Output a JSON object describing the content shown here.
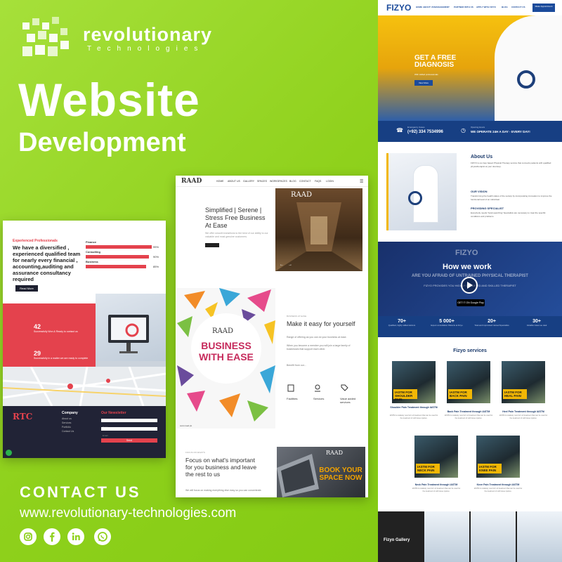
{
  "brand": {
    "name": "revolutionary",
    "sub": "Technologies"
  },
  "headline": "Website",
  "subheadline": "Development",
  "contact": {
    "title": "CONTACT US",
    "url": "www.revolutionary-technologies.com"
  },
  "social_icons": [
    "instagram-icon",
    "facebook-icon",
    "linkedin-icon",
    "whatsapp-icon"
  ],
  "colors": {
    "background": "#8fd11c",
    "accent_red": "#e4424d",
    "fizyo_blue": "#173f83",
    "fizyo_yellow": "#f2b705",
    "raad_magenta": "#c62a5b"
  },
  "left_mock": {
    "kicker": "Experienced Professionals",
    "heading": "We have a diversified , experienced qualified team for nearly every financial , accounting,auditing and assurance consultancy required",
    "read_more": "Read More",
    "bars": [
      {
        "label": "Finance",
        "pct": "95%"
      },
      {
        "label": "Consulting",
        "pct": "90%"
      },
      {
        "label": "Business",
        "pct": "85%"
      }
    ],
    "stats": [
      {
        "num": "42",
        "text": "Successfully Won & Ready to contact us"
      },
      {
        "num": "29",
        "text": "Successfully in a matter we are ready to complete"
      }
    ],
    "footer_logo": "RTC",
    "company_title": "Company",
    "company_links": [
      "About us",
      "Services",
      "Portfolio",
      "Contact Us"
    ],
    "newsletter_title": "Our Newsletter",
    "newsletter_name": "Name",
    "newsletter_email": "Email",
    "newsletter_send": "Send"
  },
  "center_mock": {
    "logo": "RAAD",
    "nav": [
      "HOME",
      "ABOUT US",
      "GALLERY",
      "SPACES",
      "WORKSPACES",
      "BLOG",
      "CONTACT",
      "FAQS",
      "LOGIN"
    ],
    "hero_heading": "Simplified | Serene | Stress Free Business At Ease",
    "hero_text": "We offer smooth transitions to the best of our ability to our valuable and most genuine customers.",
    "poster_title": "BUSINESS WITH EASE",
    "poster_footer": "www.raad.pk",
    "section_kicker": "BUSINESS AT EASE",
    "section_heading": "Make it easy for yourself",
    "section_p1": "Range of offering as you can do your business at ease.",
    "section_p2": "When you become a member you will join a large family of businesses that support each other.",
    "section_p3": "Benefit from our...",
    "features": [
      "Facilities",
      "Services",
      "Value added services"
    ],
    "bottom_kicker": "FOCUS ON WHAT'S",
    "bottom_heading": "Focus on what's important for you business and leave the rest to us",
    "bottom_text": "We will focus on making everything else easy so you can concentrate.",
    "book_title": "BOOK YOUR SPACE NOW"
  },
  "right_mock": {
    "logo": "FIZYO",
    "nav": [
      "HOME",
      "ABOUT US",
      "MANAGEMENT",
      "PARTNER WITH US",
      "APPLY WITH FIZYO",
      "BLOG",
      "CONTACT US"
    ],
    "nav_button": "Make Appointment",
    "hero_title": "GET A FREE DIAGNOSIS",
    "hero_sub": "With skilled professionals",
    "hero_btn": "View More",
    "emergency_label": "Emergency Cases",
    "emergency_value": "(+92) 334 7534996",
    "opening_label": "Opening Hours",
    "opening_value": "WE OPERATE 24H A DAY - EVERY DAY!",
    "about_title": "About Us",
    "about_text": "FIZYO is our App based Physical Therapy service that connects patients with qualified physiotherapist at your doorstep.",
    "vision_title": "OUR VISION",
    "vision_text": "Transforming the health status of the society by incorporating innovation to improve the functional level of an individual.",
    "provide_title": "PROVIDING SPECIALIST",
    "provide_text": "Everybody needs 'hand-searching' Specialists are necessary to treat the specific conditions and problems.",
    "video_logo": "FIZYO",
    "video_heading": "How we work",
    "video_question": "ARE YOU AFRAID OF UNTRAINED PHYSICAL THERAPIST",
    "video_provide": "FIZYO PROVIDES YOU HIGHLY QUALIFIED AND SKILLED THERAPIST",
    "google_play": "GET IT ON Google Play",
    "stats": [
      {
        "num": "70+",
        "text": "Qualified, highly skilled doctors"
      },
      {
        "num": "5 000+",
        "text": "Expert consultation Patients at Fizyo"
      },
      {
        "num": "20+",
        "text": "Total and Improvised trained Specialists"
      },
      {
        "num": "30+",
        "text": "Variable cases we deal"
      }
    ],
    "services_title": "Fizyo services",
    "services": [
      {
        "tag": "IASTM FOR SHOULDER PAIN",
        "title": "Shoulder Pain Treatment through IASTM"
      },
      {
        "tag": "IASTM FOR BACK PAIN",
        "title": "Back Pain Treatment through IASTM"
      },
      {
        "tag": "IASTM FOR HEAL PAIN",
        "title": "Heel Pain Treatment through IASTM"
      },
      {
        "tag": "IASTM FOR NECK PAIN",
        "title": "Neck Pain Treatment through IASTM"
      },
      {
        "tag": "IASTM FOR KNEE PAIN",
        "title": "Knee Pain Treatment through IASTM"
      }
    ],
    "service_desc": "IASTM is relatively new form of treatment that can be used for the treatment of soft tissue injuries.",
    "gallery_title": "Fizyo Gallery"
  }
}
